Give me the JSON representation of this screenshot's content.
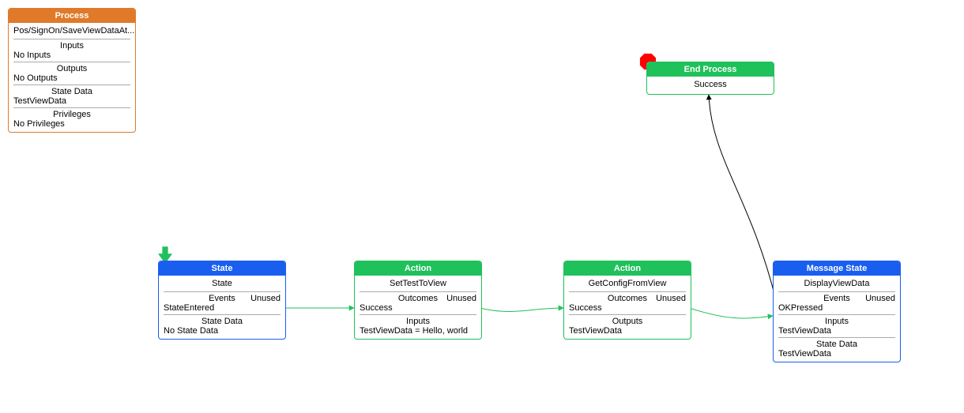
{
  "process": {
    "header": "Process",
    "title": "Pos/SignOn/SaveViewDataAt...",
    "sections": [
      {
        "label": "Inputs",
        "value": "No Inputs"
      },
      {
        "label": "Outputs",
        "value": "No Outputs"
      },
      {
        "label": "State Data",
        "value": "TestViewData"
      },
      {
        "label": "Privileges",
        "value": "No Privileges"
      }
    ]
  },
  "state": {
    "header": "State",
    "title": "State",
    "events_label": "Events",
    "events_value": "StateEntered",
    "unused": "Unused",
    "statedata_label": "State Data",
    "statedata_value": "No State Data"
  },
  "action1": {
    "header": "Action",
    "title": "SetTestToView",
    "outcomes_label": "Outcomes",
    "outcomes_value": "Success",
    "unused": "Unused",
    "inputs_label": "Inputs",
    "inputs_value": "TestViewData = Hello, world"
  },
  "action2": {
    "header": "Action",
    "title": "GetConfigFromView",
    "outcomes_label": "Outcomes",
    "outcomes_value": "Success",
    "unused": "Unused",
    "outputs_label": "Outputs",
    "outputs_value": "TestViewData"
  },
  "msgstate": {
    "header": "Message State",
    "title": "DisplayViewData",
    "events_label": "Events",
    "events_value": "OKPressed",
    "unused": "Unused",
    "inputs_label": "Inputs",
    "inputs_value": "TestViewData",
    "statedata_label": "State Data",
    "statedata_value": "TestViewData"
  },
  "end": {
    "header": "End Process",
    "title": "Success"
  },
  "chart_data": {
    "type": "diagram",
    "nodes": [
      {
        "id": "process",
        "kind": "Process",
        "label": "Pos/SignOn/SaveViewDataAt...",
        "color": "orange",
        "fields": {
          "Inputs": "No Inputs",
          "Outputs": "No Outputs",
          "State Data": "TestViewData",
          "Privileges": "No Privileges"
        }
      },
      {
        "id": "state",
        "kind": "State",
        "label": "State",
        "color": "blue",
        "entry": true,
        "fields": {
          "Events": "StateEntered",
          "Unused": true,
          "State Data": "No State Data"
        }
      },
      {
        "id": "action1",
        "kind": "Action",
        "label": "SetTestToView",
        "color": "green",
        "fields": {
          "Outcomes": "Success",
          "Unused": true,
          "Inputs": "TestViewData = Hello, world"
        }
      },
      {
        "id": "action2",
        "kind": "Action",
        "label": "GetConfigFromView",
        "color": "green",
        "fields": {
          "Outcomes": "Success",
          "Unused": true,
          "Outputs": "TestViewData"
        }
      },
      {
        "id": "msgstate",
        "kind": "Message State",
        "label": "DisplayViewData",
        "color": "blue",
        "fields": {
          "Events": "OKPressed",
          "Unused": true,
          "Inputs": "TestViewData",
          "State Data": "TestViewData"
        }
      },
      {
        "id": "end",
        "kind": "End Process",
        "label": "Success",
        "color": "green",
        "terminal": true
      }
    ],
    "edges": [
      {
        "from": "state",
        "to": "action1",
        "color": "green"
      },
      {
        "from": "action1",
        "to": "action2",
        "color": "green"
      },
      {
        "from": "action2",
        "to": "msgstate",
        "color": "green"
      },
      {
        "from": "msgstate",
        "to": "end",
        "color": "black"
      }
    ]
  }
}
